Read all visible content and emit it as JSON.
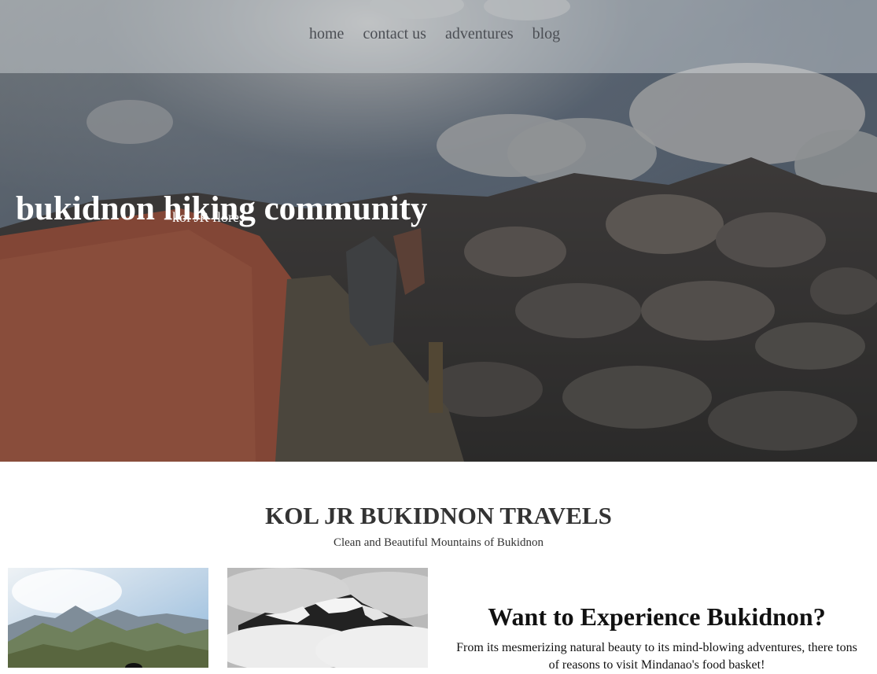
{
  "nav": {
    "items": [
      "home",
      "contact us",
      "adventures",
      "blog"
    ]
  },
  "hero": {
    "title": "bukidnon hiking community",
    "subtitle": "kol JR flores"
  },
  "main": {
    "title": "KOL JR BUKIDNON TRAVELS",
    "tagline": "Clean and Beautiful Mountains of Bukidnon"
  },
  "promo": {
    "title": "Want to Experience Bukidnon?",
    "text": "From its mesmerizing natural beauty to its mind-blowing adventures, there tons of reasons to visit Mindanao's food basket!"
  },
  "colors": {
    "nav_text": "#4b4e54",
    "hero_text": "#ffffff",
    "body_text": "#333333"
  }
}
